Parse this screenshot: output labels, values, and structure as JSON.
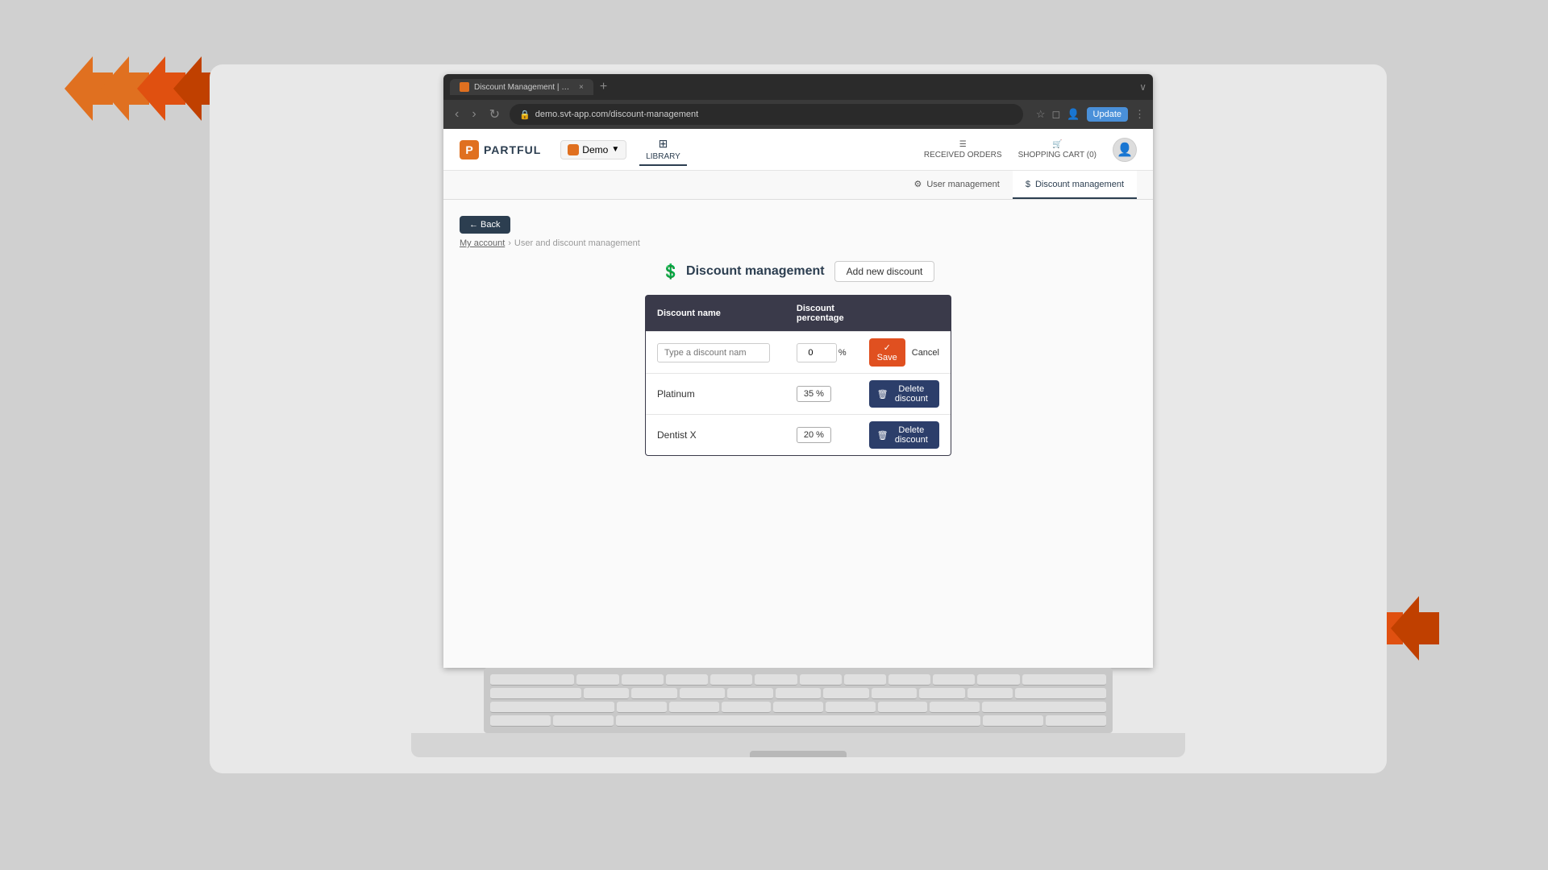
{
  "decorative": {
    "arrows_topleft_count": 4,
    "arrows_bottomright_count": 4,
    "arrow_color_orange": "#e07020",
    "arrow_color_dark": "#c05010"
  },
  "browser": {
    "tab_title": "Discount Management | Demo",
    "tab_close": "×",
    "new_tab": "+",
    "url": "demo.svt-app.com/discount-management",
    "nav_back": "‹",
    "nav_forward": "›",
    "nav_refresh": "↻",
    "update_label": "Update",
    "expand_icon": "∨"
  },
  "header": {
    "logo_letter": "P",
    "logo_name": "PARTFUL",
    "org_name": "Demo",
    "nav_library": "LIBRARY",
    "nav_received_orders": "RECEIVED ORDERS",
    "nav_shopping_cart": "SHOPPING CART (0)"
  },
  "sub_tabs": [
    {
      "id": "user-management",
      "label": "User management",
      "active": false
    },
    {
      "id": "discount-management",
      "label": "Discount management",
      "active": true
    }
  ],
  "page": {
    "back_label": "← Back",
    "breadcrumb_root": "My account",
    "breadcrumb_sep": "›",
    "breadcrumb_current": "User and discount management",
    "title": "Discount management",
    "add_button": "Add new discount"
  },
  "table": {
    "col_name": "Discount name",
    "col_percentage": "Discount percentage",
    "new_row_placeholder": "Type a discount nam",
    "new_row_percentage": "0",
    "save_label": "✓ Save",
    "cancel_label": "Cancel",
    "rows": [
      {
        "id": "platinum",
        "name": "Platinum",
        "percentage": "35 %",
        "delete_label": "Delete discount"
      },
      {
        "id": "dentist-x",
        "name": "Dentist X",
        "percentage": "20 %",
        "delete_label": "Delete discount"
      }
    ]
  }
}
